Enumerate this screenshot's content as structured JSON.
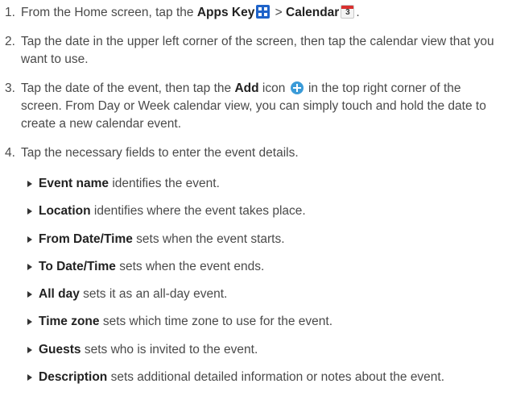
{
  "steps": [
    {
      "num": "1.",
      "pre": "From the Home screen, tap the ",
      "apps_key": "Apps Key",
      "sep": " > ",
      "calendar": "Calendar",
      "post": ".",
      "calendar_icon_day": "3",
      "icons": [
        "apps-grid-icon",
        "calendar-app-icon"
      ]
    },
    {
      "num": "2.",
      "text": "Tap the date in the upper left corner of the screen, then tap the calendar view that you want to use."
    },
    {
      "num": "3.",
      "pre": "Tap the date of the event, then tap the ",
      "add": "Add",
      "mid": " icon ",
      "post": " in the top right corner of the screen. From Day or Week calendar view, you can simply touch and hold the date to create a new calendar event.",
      "icons": [
        "add-plus-icon"
      ]
    },
    {
      "num": "4.",
      "text": "Tap the necessary fields to enter the event details."
    }
  ],
  "fields": [
    {
      "term": "Event name",
      "desc": " identifies the event."
    },
    {
      "term": "Location",
      "desc": " identifies where the event takes place."
    },
    {
      "term": "From Date/Time",
      "desc": " sets when the event starts."
    },
    {
      "term": "To Date/Time",
      "desc": " sets when the event ends."
    },
    {
      "term": "All day",
      "desc": " sets it as an all-day event."
    },
    {
      "term": "Time zone",
      "desc": " sets which time zone to use for the event."
    },
    {
      "term": "Guests",
      "desc": " sets who is invited to the event."
    },
    {
      "term": "Description",
      "desc": " sets additional detailed information or notes about the event."
    }
  ],
  "colors": {
    "text": "#4a4a4a",
    "bold": "#222222",
    "apps_icon": "#1f63c9",
    "add_icon": "#3b9bd8",
    "calendar_header": "#d9302f"
  }
}
